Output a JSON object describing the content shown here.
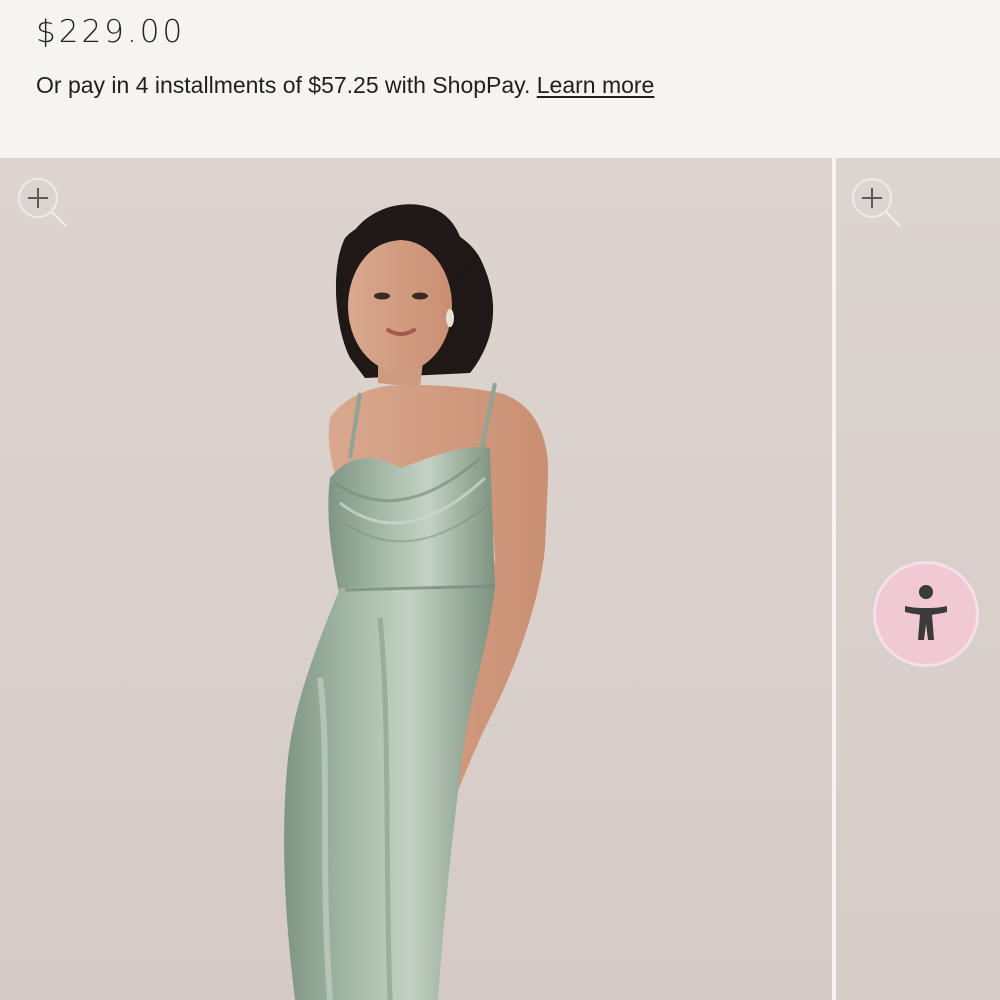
{
  "product": {
    "price": "$229.00",
    "installment_text": "Or pay in 4 installments of $57.25 with ShopPay.",
    "learn_more": "Learn more"
  },
  "gallery": {
    "main_image_alt": "Model wearing a sage green satin cowl neck slip dress",
    "next_image_alt": "Next product image"
  },
  "icons": {
    "zoom": "zoom-in-icon",
    "accessibility": "accessibility-icon"
  },
  "colors": {
    "background": "#f5f4f1",
    "dress": "#9fb3a3",
    "accessibility_button": "#f1c9d5"
  }
}
